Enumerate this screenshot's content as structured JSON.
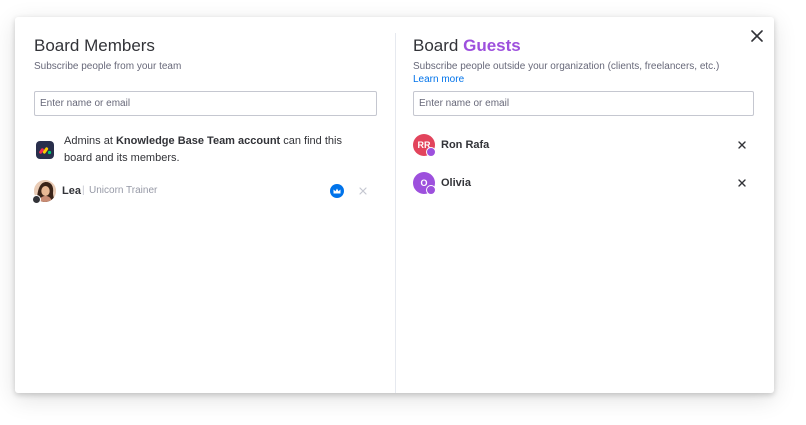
{
  "colors": {
    "accent_purple": "#9d50dd",
    "link_blue": "#0073ea",
    "avatar_rr": "#e2445c",
    "avatar_o": "#9d50dd",
    "text_primary": "#323338",
    "text_secondary": "#676879"
  },
  "dialog": {
    "close_icon": "close-icon"
  },
  "members_panel": {
    "title": "Board Members",
    "subtitle": "Subscribe people from your team",
    "search_placeholder": "Enter name or email",
    "info": {
      "prefix": "Admins at ",
      "account_name": "Knowledge Base Team account",
      "suffix": " can find this board and its members."
    },
    "members": [
      {
        "name": "Lea",
        "separator": "|",
        "role": "Unicorn Trainer",
        "owner_icon": "crown-icon",
        "remove_icon": "close-icon"
      }
    ]
  },
  "guests_panel": {
    "title_prefix": "Board ",
    "title_accent": "Guests",
    "subtitle": "Subscribe people outside your organization (clients, freelancers, etc.)",
    "learn_more": "Learn more",
    "search_placeholder": "Enter name or email",
    "guests": [
      {
        "initials": "RR",
        "name": "Ron Rafa"
      },
      {
        "initials": "O",
        "name": "Olivia"
      }
    ]
  }
}
